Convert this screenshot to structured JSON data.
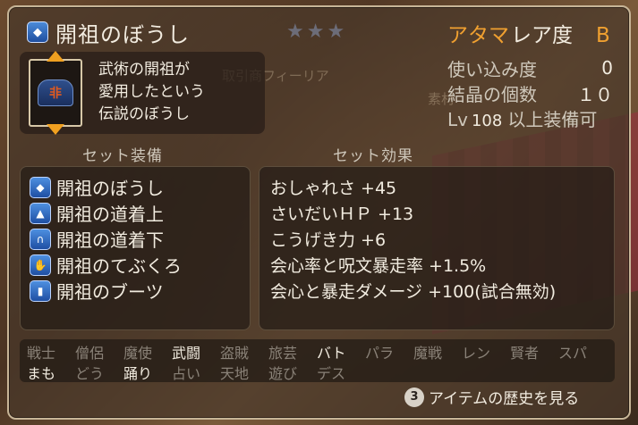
{
  "item": {
    "name": "開祖のぼうし",
    "stars": "★★★",
    "slot": "アタマ",
    "rarity_label": "レア度",
    "rarity_grade": "B",
    "description": [
      "武術の開祖が",
      "愛用したという",
      "伝説のぼうし"
    ]
  },
  "stats": {
    "usage_label": "使い込み度",
    "usage_value": "0",
    "crystal_label": "結晶の個数",
    "crystal_value": "１０",
    "level_prefix": "Lv",
    "level_value": "108",
    "level_suffix": "以上装備可"
  },
  "background": {
    "npc_name": "取引商フィーリア",
    "npc_sub": "素材"
  },
  "set": {
    "heading": "セット装備",
    "items": [
      {
        "name": "開祖のぼうし",
        "icon": "hat-icon"
      },
      {
        "name": "開祖の道着上",
        "icon": "body-top-icon"
      },
      {
        "name": "開祖の道着下",
        "icon": "body-bottom-icon"
      },
      {
        "name": "開祖のてぶくろ",
        "icon": "gloves-icon"
      },
      {
        "name": "開祖のブーツ",
        "icon": "boots-icon"
      }
    ]
  },
  "effects": {
    "heading": "セット効果",
    "items": [
      "おしゃれさ +45",
      "さいだいＨＰ +13",
      "こうげき力 +6",
      "会心率と呪文暴走率 +1.5%",
      "会心と暴走ダメージ +100(試合無効)"
    ]
  },
  "jobs": {
    "row1": [
      {
        "name": "戦士",
        "on": false
      },
      {
        "name": "僧侶",
        "on": false
      },
      {
        "name": "魔使",
        "on": false
      },
      {
        "name": "武闘",
        "on": true
      },
      {
        "name": "盗賊",
        "on": false
      },
      {
        "name": "旅芸",
        "on": false
      },
      {
        "name": "バト",
        "on": true
      },
      {
        "name": "パラ",
        "on": false
      },
      {
        "name": "魔戦",
        "on": false
      },
      {
        "name": "レン",
        "on": false
      },
      {
        "name": "賢者",
        "on": false
      },
      {
        "name": "スパ",
        "on": false
      }
    ],
    "row2": [
      {
        "name": "まも",
        "on": true
      },
      {
        "name": "どう",
        "on": false
      },
      {
        "name": "踊り",
        "on": true
      },
      {
        "name": "占い",
        "on": false
      },
      {
        "name": "天地",
        "on": false
      },
      {
        "name": "遊び",
        "on": false
      },
      {
        "name": "デス",
        "on": false
      }
    ]
  },
  "footer": {
    "button_glyph": "3",
    "history_label": "アイテムの歴史を見る"
  }
}
